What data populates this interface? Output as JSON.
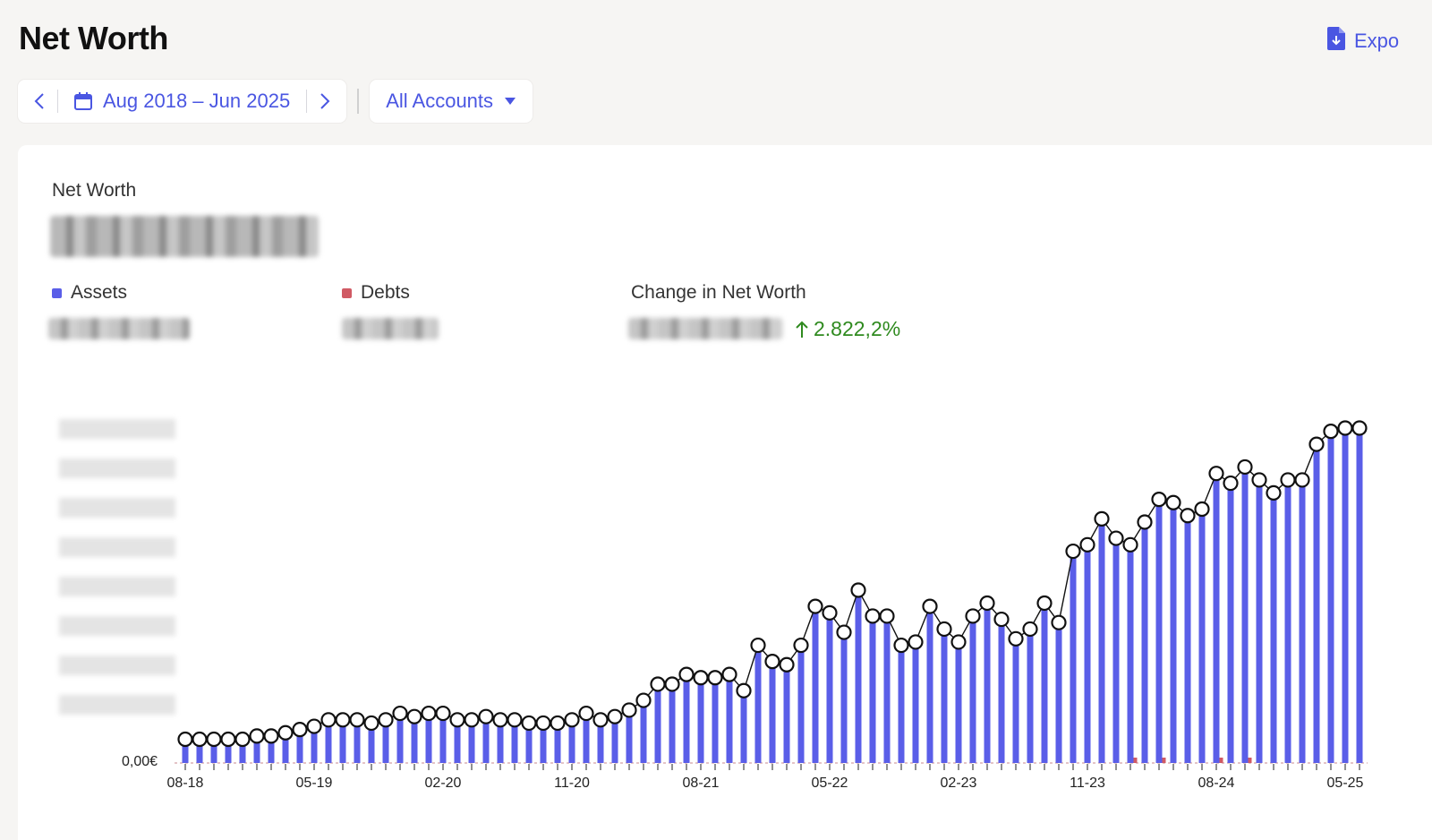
{
  "header": {
    "title": "Net Worth",
    "export_label": "Expo"
  },
  "toolbar": {
    "date_range": "Aug 2018 – Jun 2025",
    "accounts": "All Accounts"
  },
  "summary": {
    "net_worth_label": "Net Worth",
    "assets_label": "Assets",
    "debts_label": "Debts",
    "change_label": "Change in Net Worth",
    "change_pct": "2.822,2%"
  },
  "colors": {
    "accent": "#4a56e2",
    "assets": "#5a5ee8",
    "debts": "#d05a64",
    "positive": "#2f8a1f"
  },
  "chart_data": {
    "type": "bar",
    "zero_label": "0,00€",
    "x_tick_labels": [
      "08-18",
      "05-19",
      "02-20",
      "11-20",
      "08-21",
      "05-22",
      "02-23",
      "11-23",
      "08-24",
      "05-25"
    ],
    "categories": [
      "08-18",
      "09-18",
      "10-18",
      "11-18",
      "12-18",
      "01-19",
      "02-19",
      "03-19",
      "04-19",
      "05-19",
      "06-19",
      "07-19",
      "08-19",
      "09-19",
      "10-19",
      "11-19",
      "12-19",
      "01-20",
      "02-20",
      "03-20",
      "04-20",
      "05-20",
      "06-20",
      "07-20",
      "08-20",
      "09-20",
      "10-20",
      "11-20",
      "12-20",
      "01-21",
      "02-21",
      "03-21",
      "04-21",
      "05-21",
      "06-21",
      "07-21",
      "08-21",
      "09-21",
      "10-21",
      "11-21",
      "12-21",
      "01-22",
      "02-22",
      "03-22",
      "04-22",
      "05-22",
      "06-22",
      "07-22",
      "08-22",
      "09-22",
      "10-22",
      "11-22",
      "12-22",
      "01-23",
      "02-23",
      "03-23",
      "04-23",
      "05-23",
      "06-23",
      "07-23",
      "08-23",
      "09-23",
      "10-23",
      "11-23",
      "12-23",
      "01-24",
      "02-24",
      "03-24",
      "04-24",
      "05-24",
      "06-24",
      "07-24",
      "08-24",
      "09-24",
      "10-24",
      "11-24",
      "12-24",
      "01-25",
      "02-25",
      "03-25",
      "04-25",
      "05-25",
      "06-25"
    ],
    "series": [
      {
        "name": "Assets",
        "values": [
          4,
          4,
          4,
          4,
          4,
          5,
          5,
          6,
          7,
          8,
          10,
          10,
          10,
          9,
          10,
          12,
          11,
          12,
          12,
          10,
          10,
          11,
          10,
          10,
          9,
          9,
          9,
          10,
          12,
          10,
          11,
          13,
          16,
          21,
          21,
          24,
          23,
          23,
          24,
          19,
          33,
          28,
          27,
          33,
          45,
          43,
          37,
          50,
          42,
          42,
          33,
          34,
          45,
          38,
          34,
          42,
          46,
          41,
          35,
          38,
          46,
          40,
          62,
          64,
          72,
          66,
          64,
          71,
          78,
          77,
          73,
          75,
          86,
          83,
          88,
          84,
          80,
          84,
          84,
          95,
          99,
          100,
          100
        ]
      },
      {
        "name": "Debts",
        "values": [
          0,
          0,
          0,
          0,
          0,
          0,
          0,
          0,
          0,
          0,
          0,
          0,
          0,
          0,
          0,
          0,
          0,
          0,
          0,
          0,
          0,
          0,
          0,
          0,
          0,
          0,
          0,
          0,
          0,
          0,
          0,
          0,
          0,
          0,
          0,
          0,
          0,
          0,
          0,
          0,
          0,
          0,
          0,
          0,
          0,
          0,
          0,
          0,
          0,
          0,
          0,
          0,
          0,
          0,
          0,
          0,
          0,
          0,
          0,
          0,
          0,
          0,
          0,
          0,
          0,
          0,
          1,
          0,
          1,
          0,
          0,
          0,
          1,
          0,
          1,
          0,
          0,
          0,
          0,
          0,
          0,
          0,
          0
        ]
      }
    ]
  }
}
